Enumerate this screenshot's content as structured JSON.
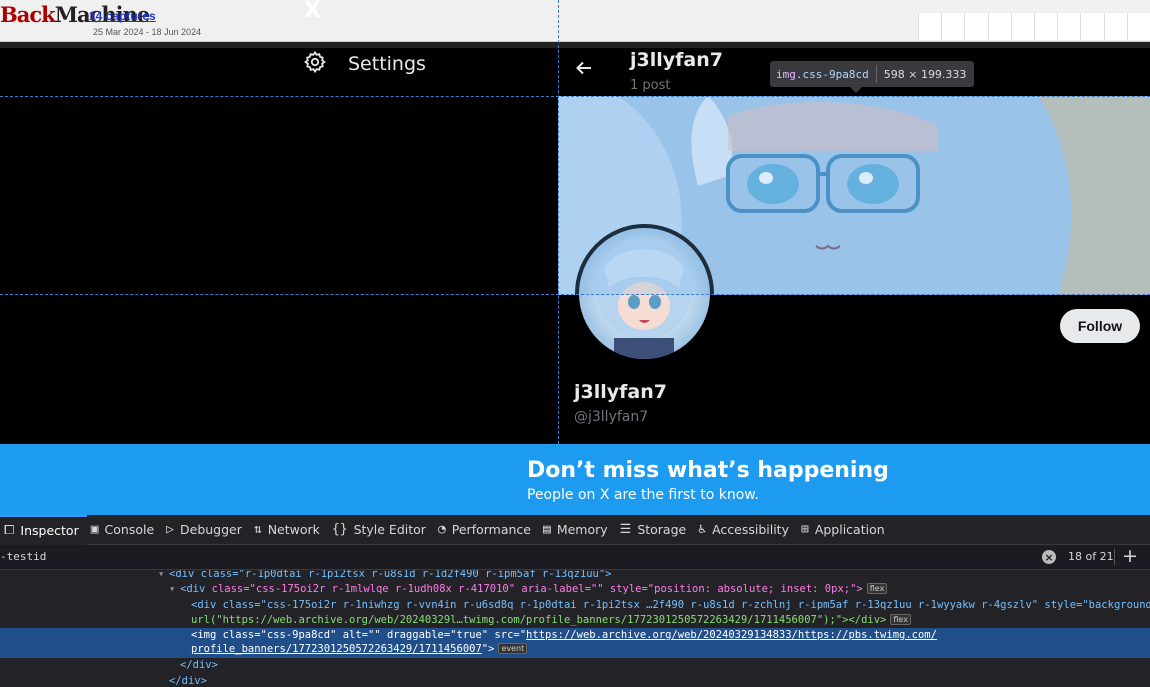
{
  "wayback": {
    "logo_a": "Back",
    "logo_b": "Machine",
    "captures": "14 captures",
    "date_range": "25 Mar 2024 - 18 Jun 2024",
    "x_logo": "X"
  },
  "sidebar": {
    "settings_label": "Settings"
  },
  "profile_header": {
    "name": "j3llyfan7",
    "posts": "1 post"
  },
  "inspector_tooltip": {
    "tag": "img",
    "class": ".css-9pa8cd",
    "dimensions": "598 × 199.333"
  },
  "profile": {
    "name": "j3llyfan7",
    "handle": "@j3llyfan7",
    "follow_label": "Follow"
  },
  "signup_banner": {
    "title": "Don’t miss what’s happening",
    "subtitle": "People on X are the first to know."
  },
  "devtools": {
    "tabs": [
      {
        "label": "Inspector",
        "icon": "inspector-icon"
      },
      {
        "label": "Console",
        "icon": "console-icon"
      },
      {
        "label": "Debugger",
        "icon": "debugger-icon"
      },
      {
        "label": "Network",
        "icon": "network-icon"
      },
      {
        "label": "Style Editor",
        "icon": "style-editor-icon"
      },
      {
        "label": "Performance",
        "icon": "performance-icon"
      },
      {
        "label": "Memory",
        "icon": "memory-icon"
      },
      {
        "label": "Storage",
        "icon": "storage-icon"
      },
      {
        "label": "Accessibility",
        "icon": "accessibility-icon"
      },
      {
        "label": "Application",
        "icon": "application-icon"
      }
    ],
    "search_query": "-testid",
    "match_count": "18 of 21",
    "tree": {
      "line1": "<div class=\"r-1p0dtai r-1pi2tsx r-u8s1d r-1d2f490 r-ipm5af r-13qz1uu\">",
      "line2_tag": "<div",
      "line2_attrs": " class=\"css-175oi2r r-1mlwlqe r-1udh08x r-417010\" aria-label=\"\" style=\"position: absolute; inset: 0px;\">",
      "line2_badge": "flex",
      "line3": "<div class=\"css-175oi2r r-1niwhzg r-vvn4in r-u6sd8q r-1p0dtai r-1pi2tsx …2f490 r-u8s1d r-zchlnj r-ipm5af r-13qz1uu r-1wyyakw r-4gszlv\" style=\"background-image:",
      "line4": "url(\"https://web.archive.org/web/20240329l…twimg.com/profile_banners/1772301250572263429/1711456007\");\"></div>",
      "line4_badge": "flex",
      "line5_pre": "<img class=\"css-9pa8cd\" alt=\"\" draggable=\"true\" src=\"",
      "line5_link": "https://web.archive.org/web/20240329134833/https://pbs.twimg.com/",
      "line6_link": "profile_banners/1772301250572263429/1711456007",
      "line6_post": "\">",
      "line6_badge": "event",
      "line7": "</div>",
      "line8": "</div>"
    }
  }
}
